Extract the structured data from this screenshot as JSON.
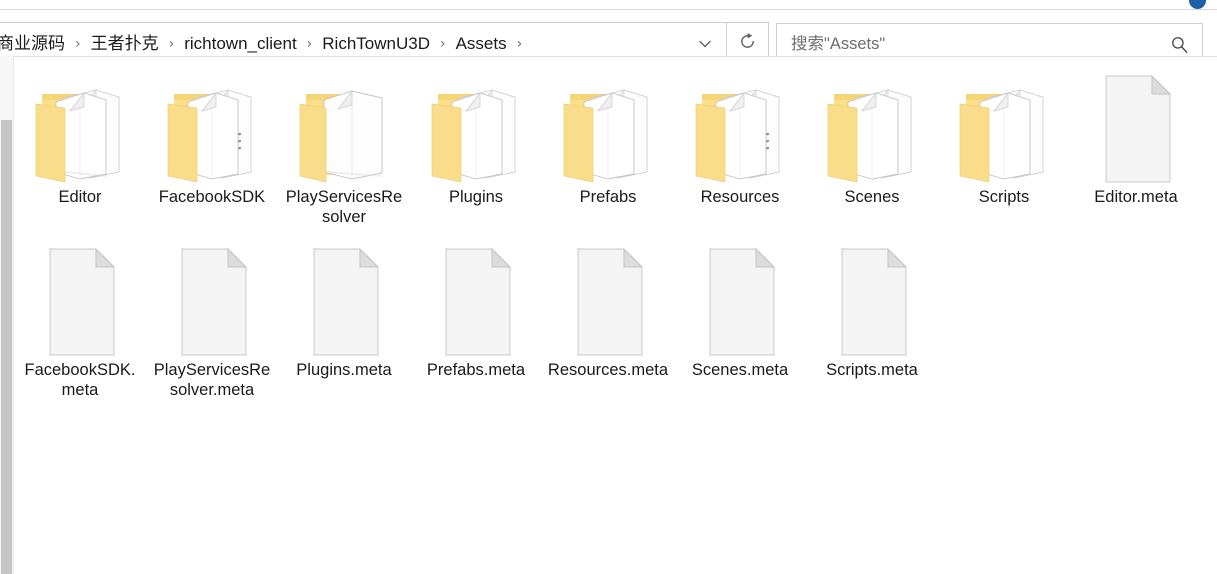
{
  "window": {
    "type": "file-explorer",
    "accent_dot_color": "#1d5fa8"
  },
  "address_bar": {
    "breadcrumbs": [
      {
        "label": "商业源码",
        "clipped": true
      },
      {
        "label": "王者扑克"
      },
      {
        "label": "richtown_client"
      },
      {
        "label": "RichTownU3D"
      },
      {
        "label": "Assets"
      }
    ],
    "separator": "›",
    "dropdown_icon": "chevron-down-icon",
    "refresh_icon": "refresh-icon",
    "refresh_glyph": "↻"
  },
  "search": {
    "placeholder": "搜索\"Assets\"",
    "value": "",
    "icon": "search-icon"
  },
  "scrollbar": {
    "orientation": "vertical",
    "position": "left",
    "track_color": "#f7f7f7",
    "thumb_color": "#c4c4c4"
  },
  "items": [
    {
      "name": "Editor",
      "type": "folder",
      "icon": "folder-papers-icon"
    },
    {
      "name": "FacebookSDK",
      "type": "folder",
      "icon": "folder-code-icon"
    },
    {
      "name": "PlayServicesResolver",
      "type": "folder",
      "icon": "folder-single-paper-icon"
    },
    {
      "name": "Plugins",
      "type": "folder",
      "icon": "folder-papers-icon"
    },
    {
      "name": "Prefabs",
      "type": "folder",
      "icon": "folder-papers-icon"
    },
    {
      "name": "Resources",
      "type": "folder",
      "icon": "folder-code-icon"
    },
    {
      "name": "Scenes",
      "type": "folder",
      "icon": "folder-papers-icon"
    },
    {
      "name": "Scripts",
      "type": "folder",
      "icon": "folder-papers-icon"
    },
    {
      "name": "Editor.meta",
      "type": "file",
      "icon": "blank-document-icon"
    },
    {
      "name": "FacebookSDK.meta",
      "type": "file",
      "icon": "blank-document-icon"
    },
    {
      "name": "PlayServicesResolver.meta",
      "type": "file",
      "icon": "blank-document-icon"
    },
    {
      "name": "Plugins.meta",
      "type": "file",
      "icon": "blank-document-icon"
    },
    {
      "name": "Prefabs.meta",
      "type": "file",
      "icon": "blank-document-icon"
    },
    {
      "name": "Resources.meta",
      "type": "file",
      "icon": "blank-document-icon"
    },
    {
      "name": "Scenes.meta",
      "type": "file",
      "icon": "blank-document-icon"
    },
    {
      "name": "Scripts.meta",
      "type": "file",
      "icon": "blank-document-icon"
    }
  ],
  "colors": {
    "folder_yellow": "#fade8a",
    "folder_yellow_dark": "#f2cd63",
    "paper_white": "#fdfdfd",
    "paper_edge": "#bdbdbd",
    "text": "#1a1a1a",
    "placeholder_text": "#6e6e6e",
    "border": "#cfcfcf"
  }
}
